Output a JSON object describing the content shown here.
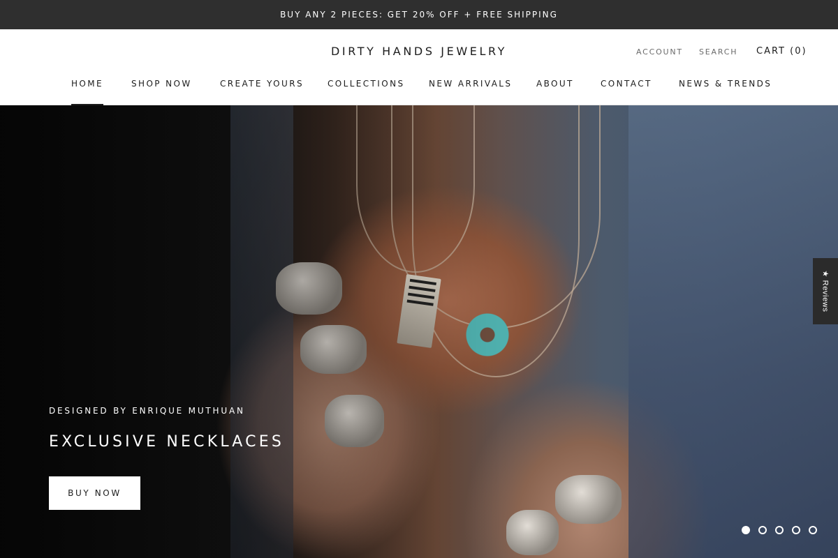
{
  "announcement": "BUY ANY 2 PIECES: GET 20% OFF + FREE SHIPPING",
  "header": {
    "logo": "DIRTY HANDS JEWELRY",
    "account": "ACCOUNT",
    "search": "SEARCH",
    "cart": "CART (0)"
  },
  "nav": [
    {
      "label": "HOME",
      "active": true
    },
    {
      "label": "SHOP NOW"
    },
    {
      "label": "CREATE YOURS"
    },
    {
      "label": "COLLECTIONS"
    },
    {
      "label": "NEW ARRIVALS"
    },
    {
      "label": "ABOUT"
    },
    {
      "label": "CONTACT"
    },
    {
      "label": "NEWS & TRENDS"
    }
  ],
  "hero": {
    "eyebrow": "DESIGNED BY ENRIQUE MUTHUAN",
    "title": "EXCLUSIVE NECKLACES",
    "button": "BUY NOW",
    "slides_total": 5,
    "active_slide": 1
  },
  "reviews_tab": "★ Reviews",
  "colors": {
    "announcement_bg": "#2f2f2f",
    "text": "#1c1c1c",
    "reviews_tab_bg": "#2b2b2b"
  }
}
